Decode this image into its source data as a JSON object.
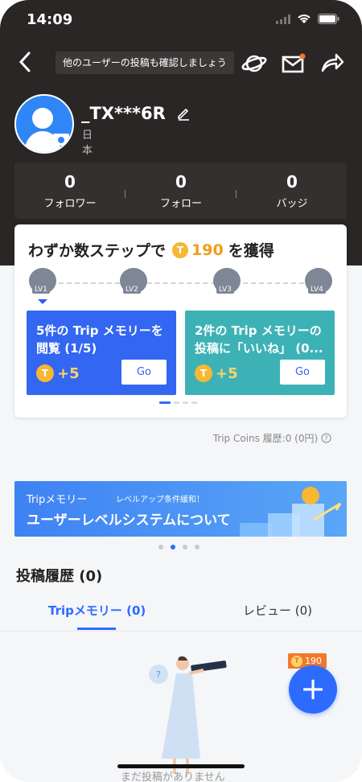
{
  "status_bar": {
    "time": "14:09"
  },
  "nav": {
    "tooltip": "他のユーザーの投稿も確認しましょう"
  },
  "profile": {
    "username": "_TX***6R",
    "country": "日本"
  },
  "stats": [
    {
      "value": "0",
      "label": "フォロワー"
    },
    {
      "value": "0",
      "label": "フォロー"
    },
    {
      "value": "0",
      "label": "バッジ"
    }
  ],
  "reward_card": {
    "title_prefix": "わずか数ステップで",
    "coin_amount": "190",
    "title_suffix": "を獲得",
    "levels": [
      "LV1",
      "LV2",
      "LV3",
      "LV4"
    ],
    "tasks": [
      {
        "text": "5件の Trip メモリーを閲覧 (1/5)",
        "reward": "+5",
        "button": "Go"
      },
      {
        "text": "2件の Trip メモリーの投稿に「いいね」 (0...",
        "reward": "+5",
        "button": "Go"
      }
    ]
  },
  "coins_history": "Trip Coins 履歴:0 (0円)",
  "banner": {
    "brand": "Tripメモリー",
    "tag": "レベルアップ条件緩和！",
    "headline": "ユーザーレベルシステムについて"
  },
  "history": {
    "title": "投稿履歴 (0)",
    "tabs": [
      "Tripメモリー (0)",
      "レビュー (0)"
    ]
  },
  "fab": {
    "badge": "190",
    "label": "+"
  },
  "empty_state": "まだ投稿がありません",
  "colors": {
    "accent": "#2d6bff",
    "coin": "#f7b733",
    "teal": "#3db2b6",
    "orange": "#f07a2b"
  }
}
